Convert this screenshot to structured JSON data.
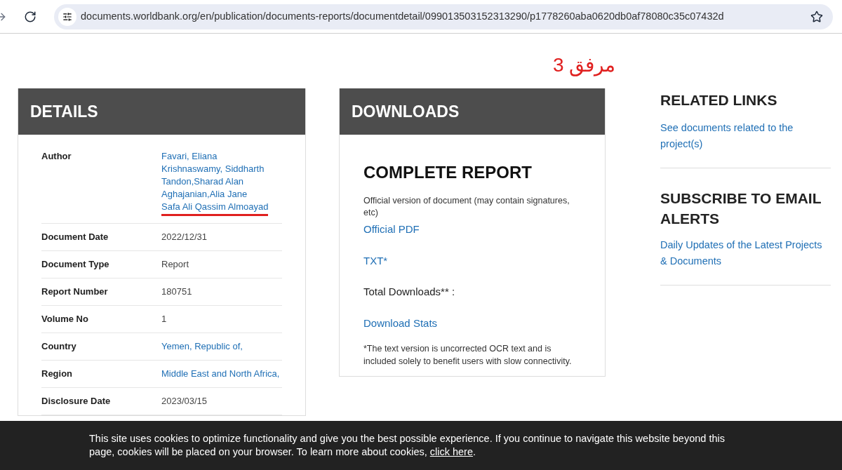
{
  "browser": {
    "url": "documents.worldbank.org/en/publication/documents-reports/documentdetail/099013503152313290/p1778260aba0620db0af78080c35c07432d"
  },
  "annotation": "مرفق 3",
  "details": {
    "title": "DETAILS",
    "rows": [
      {
        "label": "Author",
        "values": [
          {
            "text": "Favari, Eliana",
            "link": true,
            "highlighted": false
          },
          {
            "text": "Krishnaswamy, Siddharth",
            "link": true,
            "highlighted": false
          },
          {
            "text": "Tandon,Sharad Alan",
            "link": true,
            "highlighted": false
          },
          {
            "text": "Aghajanian,Alia Jane",
            "link": true,
            "highlighted": false
          },
          {
            "text": "Safa Ali Qassim Almoayad",
            "link": true,
            "highlighted": true
          }
        ]
      },
      {
        "label": "Document Date",
        "values": [
          {
            "text": "2022/12/31",
            "link": false,
            "highlighted": false
          }
        ]
      },
      {
        "label": "Document Type",
        "values": [
          {
            "text": "Report",
            "link": false,
            "highlighted": false
          }
        ]
      },
      {
        "label": "Report Number",
        "values": [
          {
            "text": "180751",
            "link": false,
            "highlighted": false
          }
        ]
      },
      {
        "label": "Volume No",
        "values": [
          {
            "text": "1",
            "link": false,
            "highlighted": false
          }
        ]
      },
      {
        "label": "Country",
        "values": [
          {
            "text": "Yemen, Republic of,",
            "link": true,
            "highlighted": false
          }
        ]
      },
      {
        "label": "Region",
        "values": [
          {
            "text": "Middle East and North Africa,",
            "link": true,
            "highlighted": false
          }
        ]
      },
      {
        "label": "Disclosure Date",
        "values": [
          {
            "text": "2023/03/15",
            "link": false,
            "highlighted": false
          }
        ]
      }
    ]
  },
  "downloads": {
    "title": "DOWNLOADS",
    "heading": "COMPLETE REPORT",
    "note": "Official version of document (may contain signatures, etc)",
    "pdf_link": "Official PDF",
    "txt_link": "TXT*",
    "total_label": "Total Downloads** :",
    "stats_link": "Download Stats",
    "footnote": "*The text version is uncorrected OCR text and is included solely to benefit users with slow connectivity."
  },
  "related": {
    "title": "RELATED LINKS",
    "link": "See documents related to the project(s)"
  },
  "subscribe": {
    "title": "SUBSCRIBE TO EMAIL ALERTS",
    "link": "Daily Updates of the Latest Projects & Documents"
  },
  "cookie_banner": {
    "text": "This site uses cookies to optimize functionality and give you the best possible experience. If you continue to navigate this website beyond this page, cookies will be placed on your browser. To learn more about cookies,",
    "link": "click here",
    "end": "."
  }
}
